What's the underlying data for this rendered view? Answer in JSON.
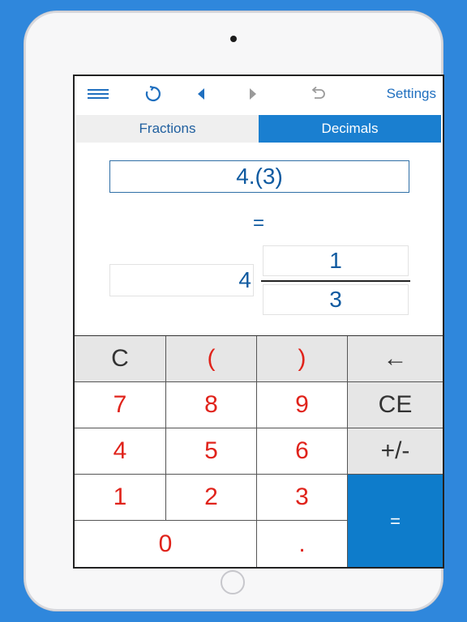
{
  "toolbar": {
    "menu_icon": "hamburger-icon",
    "refresh_icon": "refresh-icon",
    "back_icon": "triangle-left-icon",
    "forward_icon": "triangle-right-icon",
    "undo_icon": "undo-icon",
    "settings_label": "Settings"
  },
  "tabs": [
    {
      "label": "Fractions",
      "active": false
    },
    {
      "label": "Decimals",
      "active": true
    }
  ],
  "input": {
    "decimal_value": "4.(3)"
  },
  "equals_sign": "=",
  "result": {
    "whole": "4",
    "numerator": "1",
    "denominator": "3"
  },
  "keypad": {
    "clear": "C",
    "paren_open": "(",
    "paren_close": ")",
    "backspace": "←",
    "k7": "7",
    "k8": "8",
    "k9": "9",
    "clear_entry": "CE",
    "k4": "4",
    "k5": "5",
    "k6": "6",
    "sign": "+/-",
    "k1": "1",
    "k2": "2",
    "k3": "3",
    "equals": "=",
    "k0": "0",
    "dot": "."
  },
  "colors": {
    "background": "#2f87dc",
    "accent_blue": "#1a7fd0",
    "digit_red": "#e0231b",
    "text_blue": "#0f5aa0"
  }
}
